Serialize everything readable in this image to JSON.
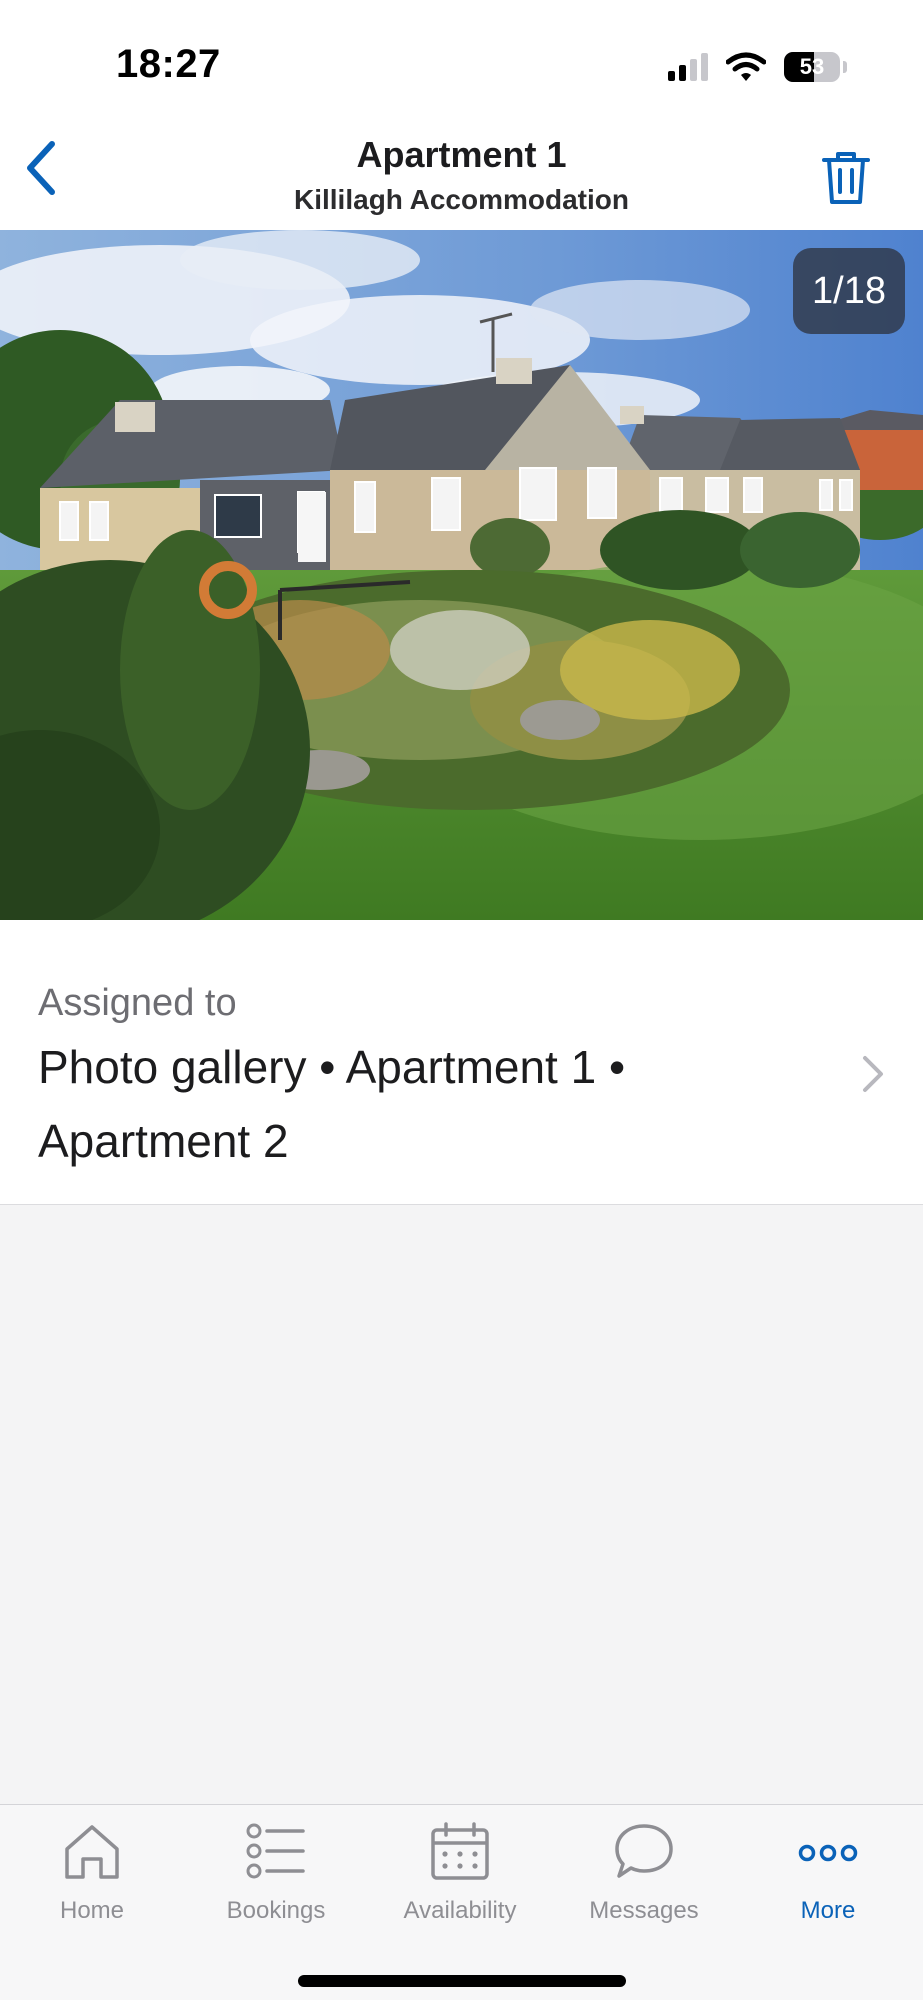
{
  "status_bar": {
    "time": "18:27",
    "battery_percent": "53",
    "battery_level": 0.53,
    "icons": [
      "signal-icon",
      "wifi-icon",
      "battery-icon"
    ]
  },
  "nav": {
    "title": "Apartment 1",
    "subtitle": "Killilagh Accommodation",
    "back_icon": "chevron-left-icon",
    "delete_icon": "trash-icon"
  },
  "photo": {
    "counter": "1/18",
    "current": 1,
    "total": 18
  },
  "assigned": {
    "label": "Assigned to",
    "value": "Photo gallery • Apartment 1 • Apartment 2",
    "chevron_icon": "chevron-right-icon"
  },
  "tabs": [
    {
      "label": "Home",
      "icon": "home-icon",
      "active": false
    },
    {
      "label": "Bookings",
      "icon": "list-icon",
      "active": false
    },
    {
      "label": "Availability",
      "icon": "calendar-icon",
      "active": false
    },
    {
      "label": "Messages",
      "icon": "chat-bubble-icon",
      "active": false
    },
    {
      "label": "More",
      "icon": "more-dots-icon",
      "active": true
    }
  ],
  "colors": {
    "accent": "#0a62b8",
    "tab_inactive": "#8e8e93",
    "background": "#f4f4f5"
  }
}
